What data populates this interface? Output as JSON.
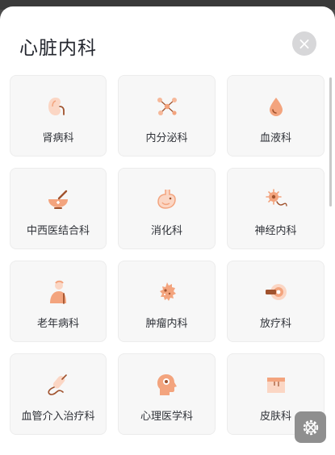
{
  "modal": {
    "title": "心脏内科",
    "close_icon": "close-icon"
  },
  "departments": [
    {
      "label": "肾病科",
      "icon": "kidney-icon"
    },
    {
      "label": "内分泌科",
      "icon": "molecule-icon"
    },
    {
      "label": "血液科",
      "icon": "blood-drop-icon"
    },
    {
      "label": "中西医结合科",
      "icon": "mortar-pestle-icon"
    },
    {
      "label": "消化科",
      "icon": "stomach-icon"
    },
    {
      "label": "神经内科",
      "icon": "neuron-icon"
    },
    {
      "label": "老年病科",
      "icon": "elderly-person-icon"
    },
    {
      "label": "肿瘤内科",
      "icon": "tumor-cell-icon"
    },
    {
      "label": "放疗科",
      "icon": "radiation-device-icon"
    },
    {
      "label": "血管介入治疗科",
      "icon": "catheter-icon"
    },
    {
      "label": "心理医学科",
      "icon": "head-brain-icon"
    },
    {
      "label": "皮肤科",
      "icon": "skin-layer-icon"
    }
  ],
  "colors": {
    "accent": "#f3a47e",
    "accent_light": "#fbd6c4",
    "accent_dark": "#a0522d"
  },
  "floating_tool": {
    "icon": "settings-tool-icon"
  }
}
